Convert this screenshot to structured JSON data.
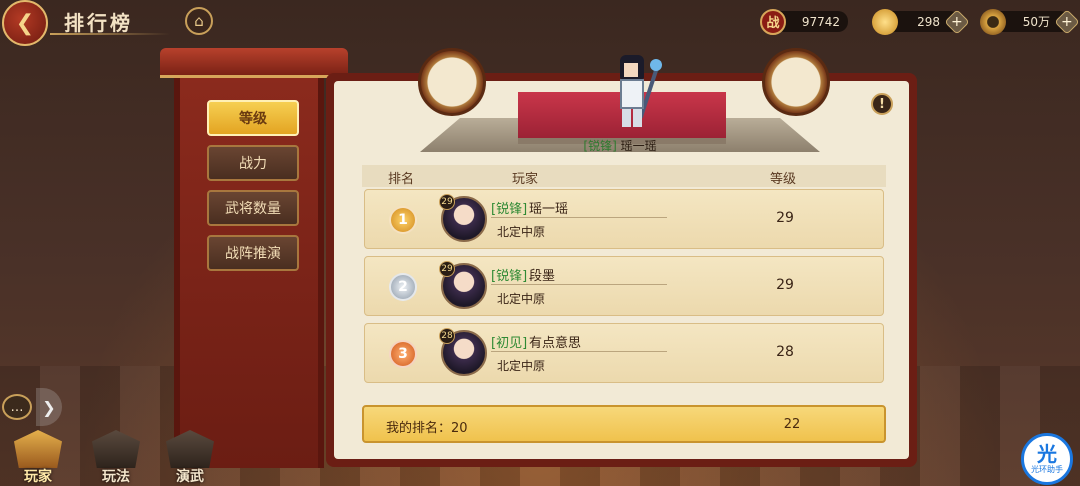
{
  "header": {
    "title": "排行榜",
    "back_icon": "back-arrow-icon",
    "home_icon": "home-icon"
  },
  "resources": [
    {
      "name": "battle-power",
      "icon_text": "战",
      "value": "97742",
      "color": "#c0392b"
    },
    {
      "name": "gold-ingot",
      "icon_text": "",
      "value": "298",
      "color": "#e8b53a"
    },
    {
      "name": "coin",
      "icon_text": "",
      "value": "50万",
      "color": "#d9a441"
    }
  ],
  "nav": {
    "items": [
      {
        "label": "等级",
        "active": true
      },
      {
        "label": "战力",
        "active": false
      },
      {
        "label": "武将数量",
        "active": false
      },
      {
        "label": "战阵推演",
        "active": false
      }
    ]
  },
  "podium": {
    "tag": "[锐锋]",
    "name": "瑶一瑶"
  },
  "table": {
    "col_rank": "排名",
    "col_player": "玩家",
    "col_level": "等级",
    "rows": [
      {
        "rank": "1",
        "rank_color": "#e0a030",
        "avatar_level": "29",
        "tag": "[锐锋]",
        "name": "瑶一瑶",
        "server": "北定中原",
        "level": "29"
      },
      {
        "rank": "2",
        "rank_color": "#9aa6b4",
        "avatar_level": "29",
        "tag": "[锐锋]",
        "name": "段墨",
        "server": "北定中原",
        "level": "29"
      },
      {
        "rank": "3",
        "rank_color": "#e07a35",
        "avatar_level": "28",
        "tag": "[初见]",
        "name": "有点意思",
        "server": "北定中原",
        "level": "28"
      }
    ]
  },
  "my_rank": {
    "label": "我的排名：20",
    "level": "22"
  },
  "bottom_tabs": [
    {
      "label": "玩家",
      "active": true
    },
    {
      "label": "玩法",
      "active": false
    },
    {
      "label": "演武",
      "active": false
    }
  ],
  "helper": {
    "mark": "光",
    "label": "光环助手"
  }
}
